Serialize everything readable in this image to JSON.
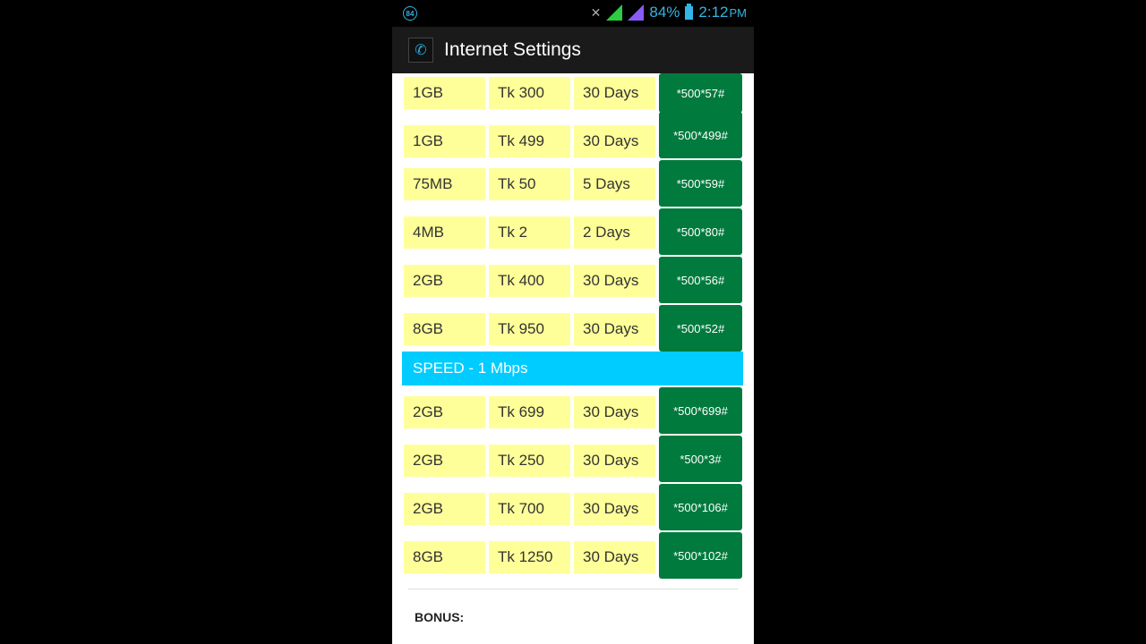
{
  "status_bar": {
    "notification_badge": "84",
    "battery": "84%",
    "time": "2:12",
    "ampm": "PM"
  },
  "action_bar": {
    "title": "Internet Settings"
  },
  "top_rows": [
    {
      "data": "1GB",
      "price": "Tk 300",
      "validity": "30 Days",
      "code": "*500*57#"
    },
    {
      "data": "1GB",
      "price": "Tk 499",
      "validity": "30 Days",
      "code": "*500*499#"
    },
    {
      "data": "75MB",
      "price": "Tk 50",
      "validity": "5 Days",
      "code": "*500*59#"
    },
    {
      "data": "4MB",
      "price": "Tk 2",
      "validity": "2 Days",
      "code": "*500*80#"
    },
    {
      "data": "2GB",
      "price": "Tk 400",
      "validity": "30 Days",
      "code": "*500*56#"
    },
    {
      "data": "8GB",
      "price": "Tk 950",
      "validity": "30 Days",
      "code": "*500*52#"
    }
  ],
  "speed_section": {
    "label": "SPEED - 1 Mbps"
  },
  "speed_rows": [
    {
      "data": "2GB",
      "price": "Tk 699",
      "validity": "30 Days",
      "code": "*500*699#"
    },
    {
      "data": "2GB",
      "price": "Tk 250",
      "validity": "30 Days",
      "code": "*500*3#"
    },
    {
      "data": "2GB",
      "price": "Tk 700",
      "validity": "30 Days",
      "code": "*500*106#"
    },
    {
      "data": "8GB",
      "price": "Tk 1250",
      "validity": "30 Days",
      "code": "*500*102#"
    }
  ],
  "bonus": {
    "label": "BONUS:"
  },
  "colors": {
    "cell_bg": "#ffff99",
    "code_bg": "#007a3d",
    "speed_bg": "#00ccff"
  }
}
